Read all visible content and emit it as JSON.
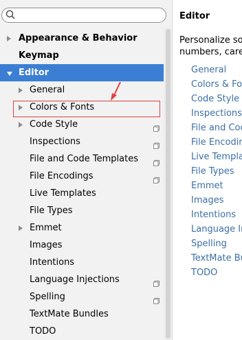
{
  "search": {
    "placeholder": ""
  },
  "tree": {
    "appearance": "Appearance & Behavior",
    "keymap": "Keymap",
    "editor": "Editor",
    "children": [
      "General",
      "Colors & Fonts",
      "Code Style",
      "Inspections",
      "File and Code Templates",
      "File Encodings",
      "Live Templates",
      "File Types",
      "Emmet",
      "Images",
      "Intentions",
      "Language Injections",
      "Spelling",
      "TextMate Bundles",
      "TODO"
    ]
  },
  "right": {
    "title": "Editor",
    "desc_line1": "Personalize sou",
    "desc_line2": "numbers, caret",
    "links": [
      "General",
      "Colors & Fon",
      "Code Style",
      "Inspections",
      "File and Code",
      "File Encoding",
      "Live Templat",
      "File Types",
      "Emmet",
      "Images",
      "Intentions",
      "Language Inj",
      "Spelling",
      "TextMate Bu",
      "TODO"
    ]
  },
  "colors": {
    "selection": "#3b7fd4",
    "link": "#3b6ea8",
    "annotation": "#e04040"
  },
  "icons": {
    "search": "search-icon",
    "expand": "chevron-right-icon",
    "collapse": "chevron-down-icon",
    "project": "project-scope-icon",
    "pointer": "red-annotation-arrow"
  }
}
